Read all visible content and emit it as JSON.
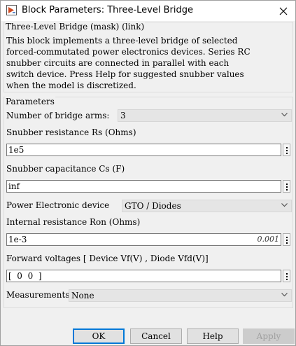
{
  "window": {
    "title": "Block Parameters: Three-Level Bridge"
  },
  "mask": {
    "heading": "Three-Level Bridge (mask) (link)",
    "description": "This block implements a three-level bridge of selected\nforced-commutated power electronics devices.  Series RC\nsnubber circuits are connected in parallel with each\nswitch device.  Press Help for suggested snubber values\nwhen the model is discretized."
  },
  "parameters": {
    "legend": "Parameters",
    "bridge_arms": {
      "label": "Number of bridge arms:",
      "value": "3"
    },
    "snubber_resistance": {
      "label": "Snubber resistance Rs (Ohms)",
      "value": "1e5"
    },
    "snubber_capacitance": {
      "label": "Snubber capacitance Cs (F)",
      "value": "inf"
    },
    "device": {
      "label": "Power Electronic device",
      "value": "GTO / Diodes"
    },
    "internal_resistance": {
      "label": "Internal resistance Ron (Ohms)",
      "value": "1e-3",
      "evaluated": "0.001"
    },
    "forward_voltages": {
      "label": "Forward voltages  [ Device Vf(V) , Diode Vfd(V)]",
      "value": "[  0  0  ]"
    },
    "measurements": {
      "label": "Measurements",
      "value": "None"
    }
  },
  "buttons": {
    "ok": "OK",
    "cancel": "Cancel",
    "help": "Help",
    "apply": "Apply"
  },
  "icons": {
    "app": "simulink-block-icon",
    "close": "close-icon",
    "dropdown": "chevron-down-icon",
    "menu": "vertical-ellipsis-icon"
  }
}
